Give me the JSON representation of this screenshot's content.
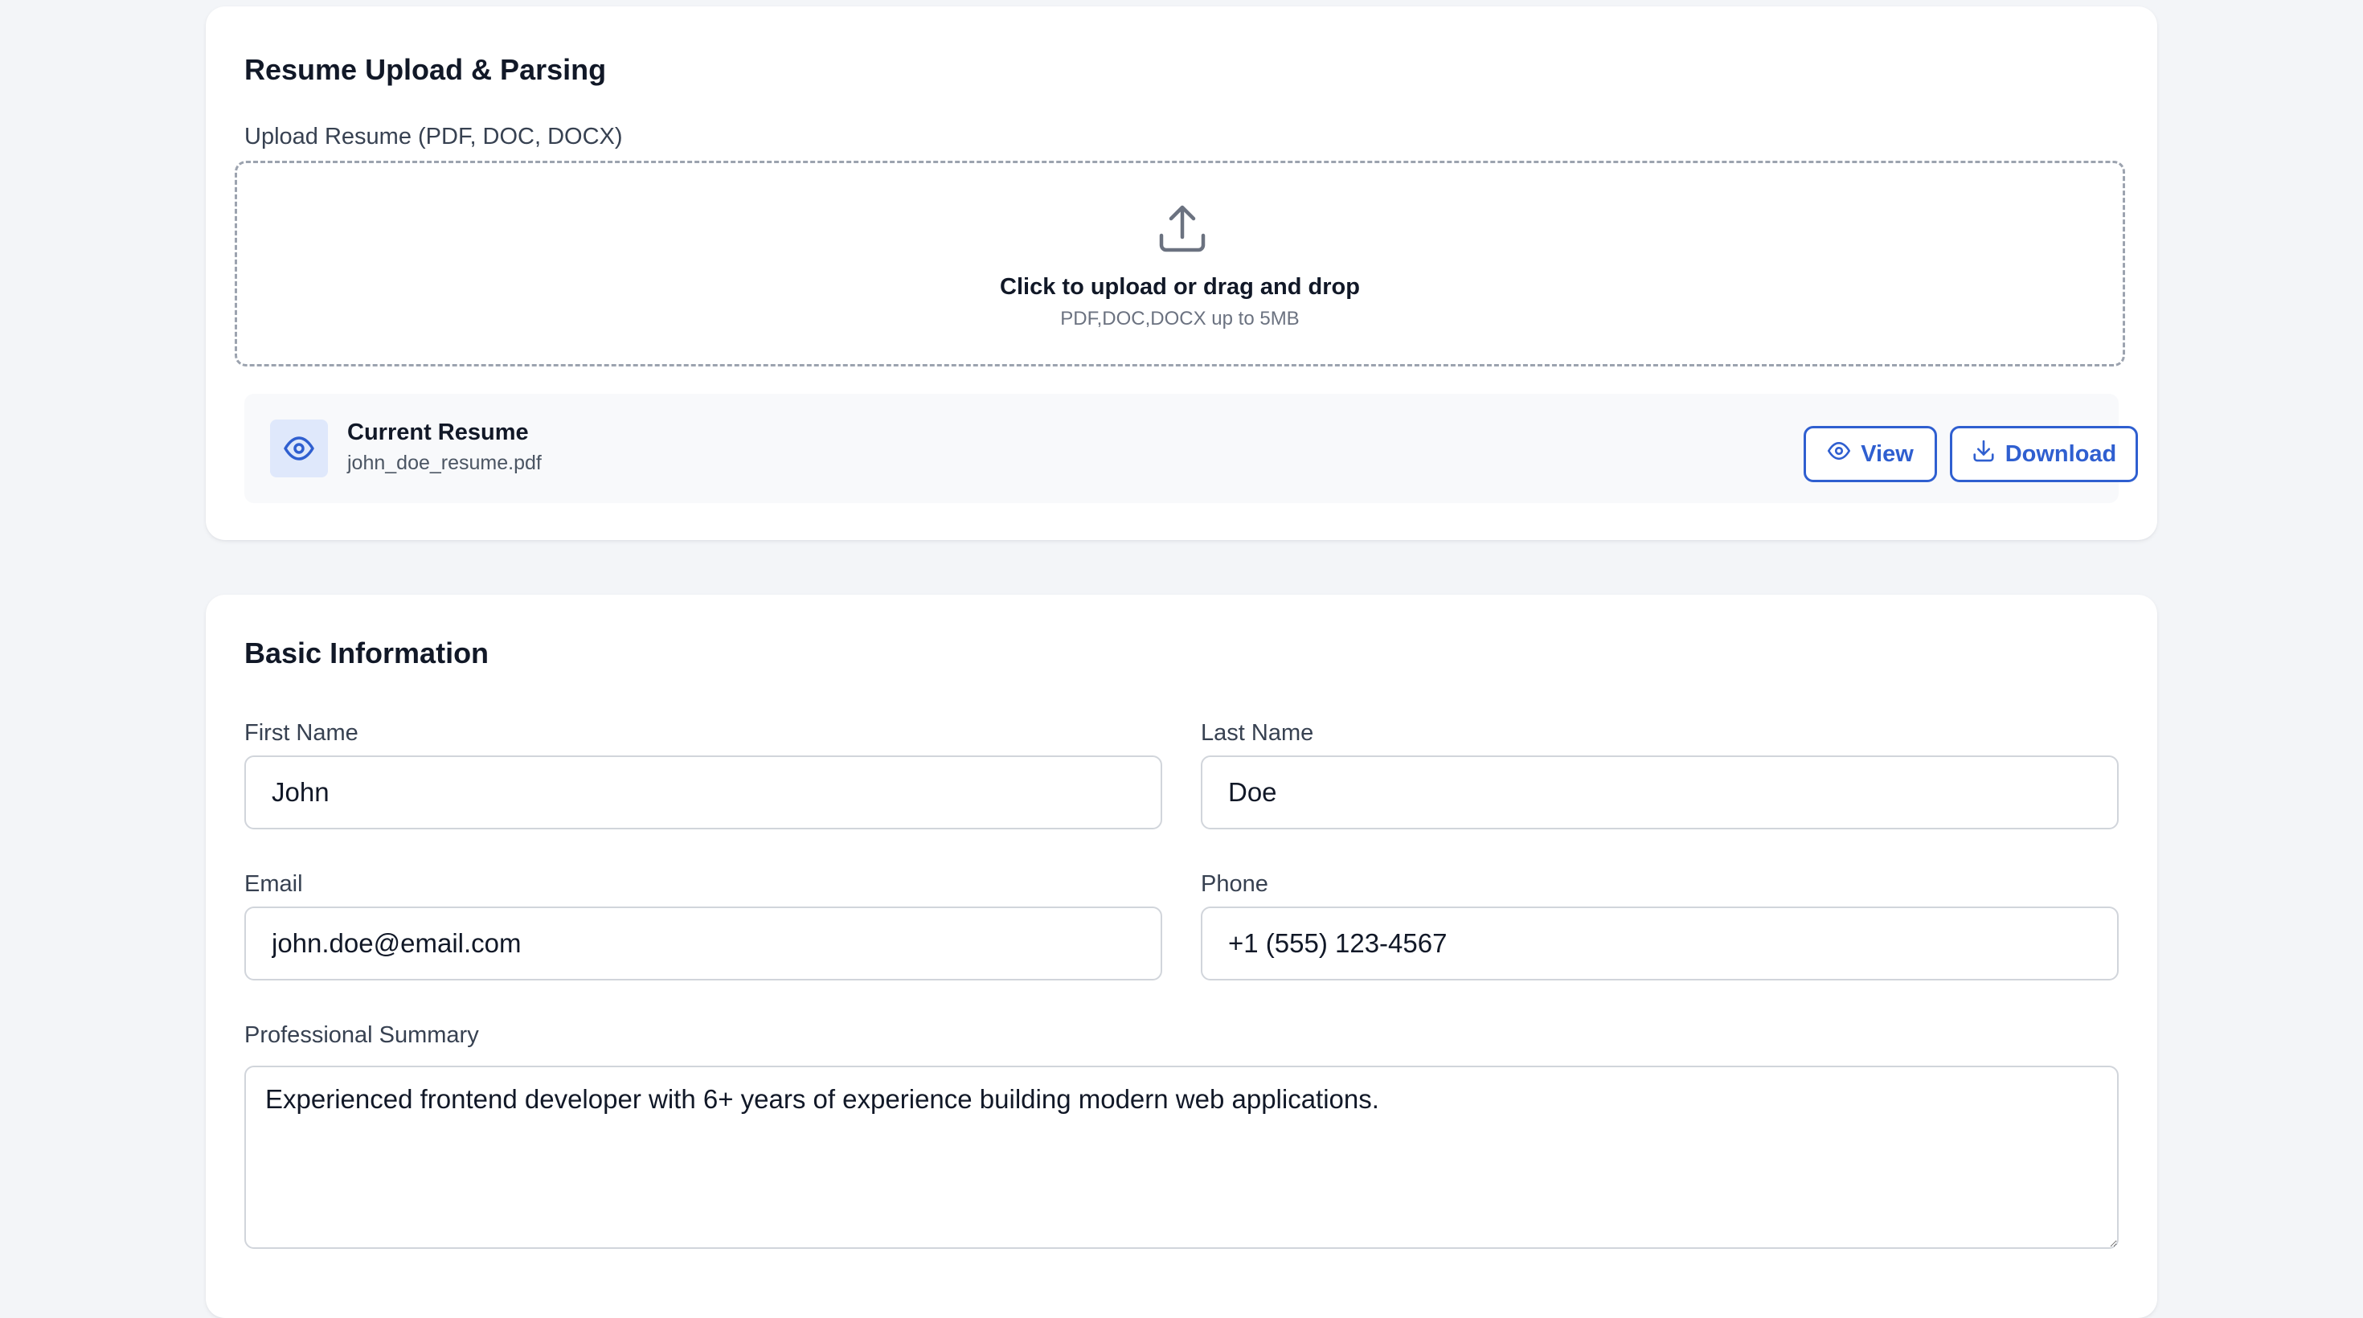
{
  "resume_section": {
    "title": "Resume Upload & Parsing",
    "upload_label": "Upload Resume (PDF, DOC, DOCX)",
    "dropzone": {
      "icon": "upload-icon",
      "main_text": "Click to upload or drag and drop",
      "sub_text": "PDF,DOC,DOCX up to 5MB"
    },
    "current_resume": {
      "icon": "eye-icon",
      "title": "Current Resume",
      "filename": "john_doe_resume.pdf",
      "view_label": "View",
      "download_label": "Download"
    }
  },
  "basic_info": {
    "title": "Basic Information",
    "first_name": {
      "label": "First Name",
      "value": "John"
    },
    "last_name": {
      "label": "Last Name",
      "value": "Doe"
    },
    "email": {
      "label": "Email",
      "value": "john.doe@email.com"
    },
    "phone": {
      "label": "Phone",
      "value": "+1 (555) 123-4567"
    },
    "summary": {
      "label": "Professional Summary",
      "value": "Experienced frontend developer with 6+ years of experience building modern web applications."
    }
  },
  "colors": {
    "accent": "#2f5fd0",
    "page_background": "#f3f5f8",
    "card_background": "#ffffff",
    "border": "#d1d5db"
  }
}
